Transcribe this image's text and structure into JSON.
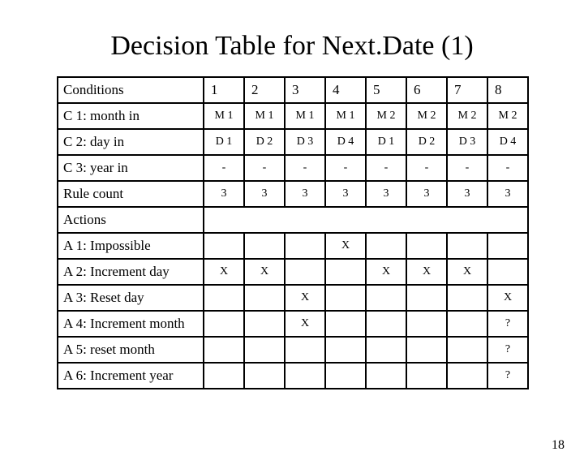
{
  "title": "Decision Table for Next.Date (1)",
  "page_number": "18",
  "chart_data": {
    "type": "table",
    "columns": [
      "1",
      "2",
      "3",
      "4",
      "5",
      "6",
      "7",
      "8"
    ],
    "section_conditions": "Conditions",
    "section_actions": "Actions",
    "conditions": [
      {
        "label": "C 1: month in",
        "cells": [
          "M 1",
          "M 1",
          "M 1",
          "M 1",
          "M 2",
          "M 2",
          "M 2",
          "M 2"
        ]
      },
      {
        "label": "C 2: day in",
        "cells": [
          "D 1",
          "D 2",
          "D 3",
          "D 4",
          "D 1",
          "D 2",
          "D 3",
          "D 4"
        ]
      },
      {
        "label": "C 3: year in",
        "cells": [
          "-",
          "-",
          "-",
          "-",
          "-",
          "-",
          "-",
          "-"
        ]
      },
      {
        "label": "Rule count",
        "cells": [
          "3",
          "3",
          "3",
          "3",
          "3",
          "3",
          "3",
          "3"
        ]
      }
    ],
    "actions": [
      {
        "label": "A 1: Impossible",
        "cells": [
          "",
          "",
          "",
          "X",
          "",
          "",
          "",
          ""
        ]
      },
      {
        "label": "A 2: Increment day",
        "cells": [
          "X",
          "X",
          "",
          "",
          "X",
          "X",
          "X",
          ""
        ]
      },
      {
        "label": "A 3: Reset day",
        "cells": [
          "",
          "",
          "X",
          "",
          "",
          "",
          "",
          "X"
        ]
      },
      {
        "label": "A 4: Increment month",
        "cells": [
          "",
          "",
          "X",
          "",
          "",
          "",
          "",
          "?"
        ]
      },
      {
        "label": "A 5: reset month",
        "cells": [
          "",
          "",
          "",
          "",
          "",
          "",
          "",
          "?"
        ]
      },
      {
        "label": "A 6: Increment year",
        "cells": [
          "",
          "",
          "",
          "",
          "",
          "",
          "",
          "?"
        ]
      }
    ]
  }
}
